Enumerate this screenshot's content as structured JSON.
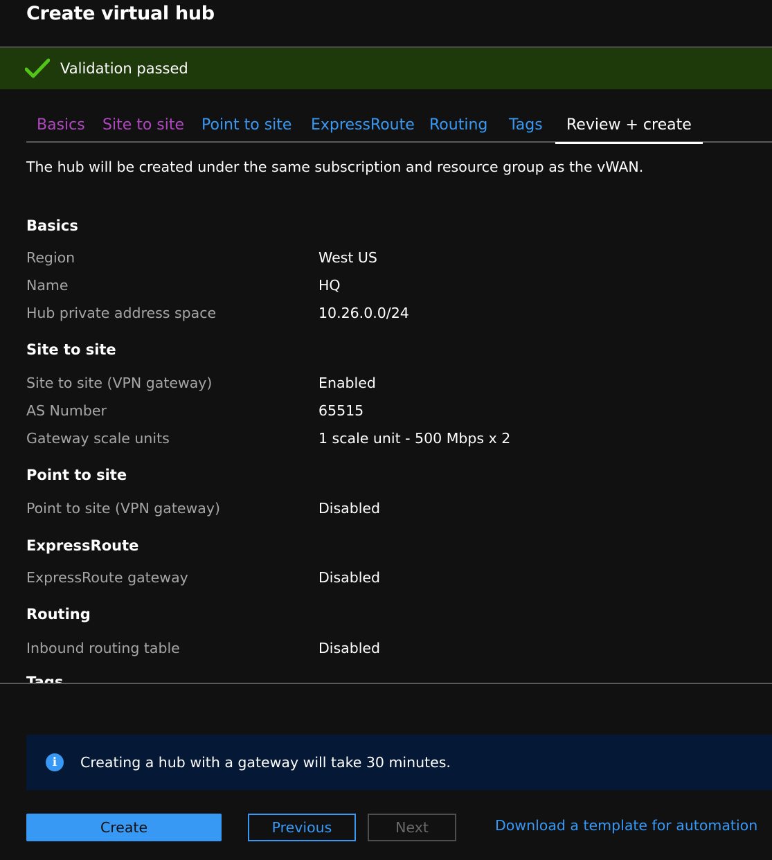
{
  "header": {
    "title": "Create virtual hub"
  },
  "validation": {
    "text": "Validation passed",
    "icon": "checkmark-icon",
    "color": "#52c41a"
  },
  "tabs": [
    {
      "label": "Basics",
      "state": "visited"
    },
    {
      "label": "Site to site",
      "state": "visited"
    },
    {
      "label": "Point to site",
      "state": "link"
    },
    {
      "label": "ExpressRoute",
      "state": "link"
    },
    {
      "label": "Routing",
      "state": "link"
    },
    {
      "label": "Tags",
      "state": "link"
    },
    {
      "label": "Review + create",
      "state": "active"
    }
  ],
  "intro": "The hub will be created under the same subscription and resource group as the vWAN.",
  "summary": {
    "basics": {
      "heading": "Basics",
      "rows": [
        {
          "label": "Region",
          "value": "West US"
        },
        {
          "label": "Name",
          "value": "HQ"
        },
        {
          "label": "Hub private address space",
          "value": "10.26.0.0/24"
        }
      ]
    },
    "site_to_site": {
      "heading": "Site to site",
      "rows": [
        {
          "label": "Site to site (VPN gateway)",
          "value": "Enabled"
        },
        {
          "label": "AS Number",
          "value": "65515"
        },
        {
          "label": "Gateway scale units",
          "value": "1 scale unit - 500 Mbps x 2"
        }
      ]
    },
    "point_to_site": {
      "heading": "Point to site",
      "rows": [
        {
          "label": "Point to site (VPN gateway)",
          "value": "Disabled"
        }
      ]
    },
    "expressroute": {
      "heading": "ExpressRoute",
      "rows": [
        {
          "label": "ExpressRoute gateway",
          "value": "Disabled"
        }
      ]
    },
    "routing": {
      "heading": "Routing",
      "rows": [
        {
          "label": "Inbound routing table",
          "value": "Disabled"
        }
      ]
    },
    "tags": {
      "heading": "Tags"
    }
  },
  "info": {
    "text": "Creating a hub with a gateway will take 30 minutes.",
    "icon": "info-icon"
  },
  "footer": {
    "create": "Create",
    "previous": "Previous",
    "next": "Next",
    "download": "Download a template for automation"
  },
  "colors": {
    "accent": "#3899f5",
    "visited_tab": "#b146c2",
    "banner_bg": "#1e3a0a",
    "info_bg": "#051937"
  }
}
